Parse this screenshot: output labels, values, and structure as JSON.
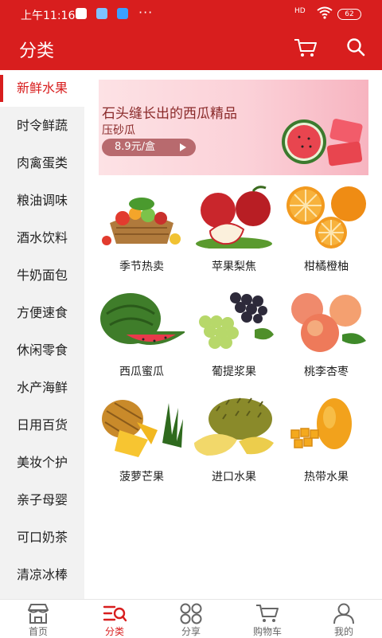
{
  "status_bar": {
    "time": "上午11:16",
    "dots": "···",
    "network": "HD",
    "battery": "62"
  },
  "header": {
    "title": "分类"
  },
  "sidebar": {
    "items": [
      {
        "label": "新鲜水果",
        "active": true
      },
      {
        "label": "时令鲜蔬"
      },
      {
        "label": "肉禽蛋类"
      },
      {
        "label": "粮油调味"
      },
      {
        "label": "酒水饮料"
      },
      {
        "label": "牛奶面包"
      },
      {
        "label": "方便速食"
      },
      {
        "label": "休闲零食"
      },
      {
        "label": "水产海鲜"
      },
      {
        "label": "日用百货"
      },
      {
        "label": "美妆个护"
      },
      {
        "label": "亲子母婴"
      },
      {
        "label": "可口奶茶"
      },
      {
        "label": "清凉冰棒"
      }
    ]
  },
  "banner": {
    "headline": "石头缝长出的西瓜精品",
    "product": "压砂瓜",
    "price": "8.9元/盒"
  },
  "grid": {
    "items": [
      {
        "label": "季节热卖"
      },
      {
        "label": "苹果梨焦"
      },
      {
        "label": "柑橘橙柚"
      },
      {
        "label": "西瓜蜜瓜"
      },
      {
        "label": "葡提浆果"
      },
      {
        "label": "桃李杏枣"
      },
      {
        "label": "菠萝芒果"
      },
      {
        "label": "进口水果"
      },
      {
        "label": "热带水果"
      }
    ]
  },
  "tabbar": {
    "items": [
      {
        "label": "首页",
        "icon": "storefront-icon"
      },
      {
        "label": "分类",
        "icon": "category-list-icon",
        "active": true
      },
      {
        "label": "分享",
        "icon": "share-grid-icon"
      },
      {
        "label": "购物车",
        "icon": "cart-icon"
      },
      {
        "label": "我的",
        "icon": "user-icon"
      }
    ]
  },
  "colors": {
    "brand": "#d81e1e",
    "sidebar_bg": "#f2f2f2",
    "text": "#222222"
  }
}
